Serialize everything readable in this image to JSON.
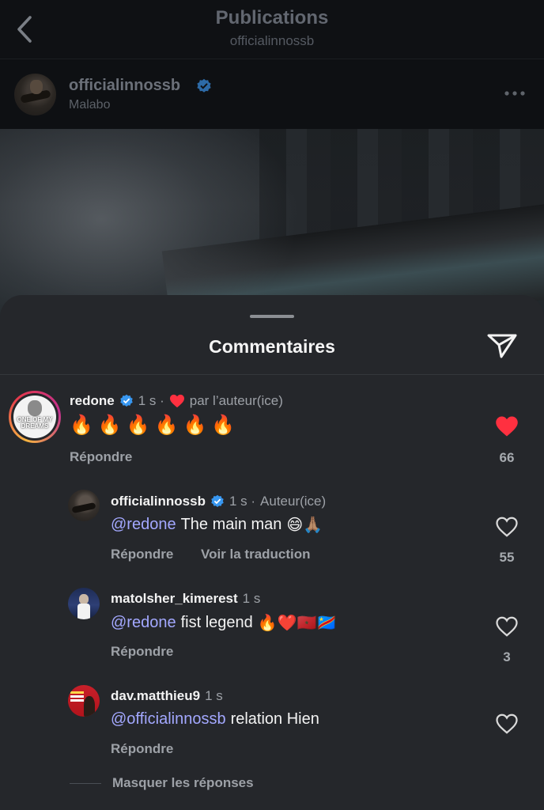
{
  "header": {
    "title": "Publications",
    "subtitle": "officialinnossb"
  },
  "post": {
    "author": "officialinnossb",
    "location": "Malabo"
  },
  "comments_sheet": {
    "title": "Commentaires"
  },
  "comments": [
    {
      "username": "redone",
      "time": "1 s ·",
      "liked_by_author_label": "par l’auteur(ice)",
      "avatar_caption": "ONE OF MY DREAMS",
      "text_emoji": "🔥🔥🔥🔥🔥🔥",
      "reply_label": "Répondre",
      "like_count": "66",
      "liked": true
    },
    {
      "username": "officialinnossb",
      "time": "1 s ·",
      "author_label": "Auteur(ice)",
      "mention": "@redone",
      "text": "The main man",
      "text_emoji": "😄🙏🏽",
      "reply_label": "Répondre",
      "translate_label": "Voir la traduction",
      "like_count": "55"
    },
    {
      "username": "matolsher_kimerest",
      "time": "1 s",
      "mention": "@redone",
      "text": "fist legend",
      "text_emoji": "🔥❤️🇲🇦🇨🇩",
      "reply_label": "Répondre",
      "like_count": "3"
    },
    {
      "username": "dav.matthieu9",
      "time": "1 s",
      "mention": "@officialinnossb",
      "text": "relation Hien",
      "reply_label": "Répondre"
    }
  ],
  "hide_replies_label": "Masquer les réponses",
  "colors": {
    "sheet_bg": "#25272b",
    "mention": "#a3a8ff",
    "like_red": "#ff3040",
    "verified_blue": "#3897f0"
  }
}
